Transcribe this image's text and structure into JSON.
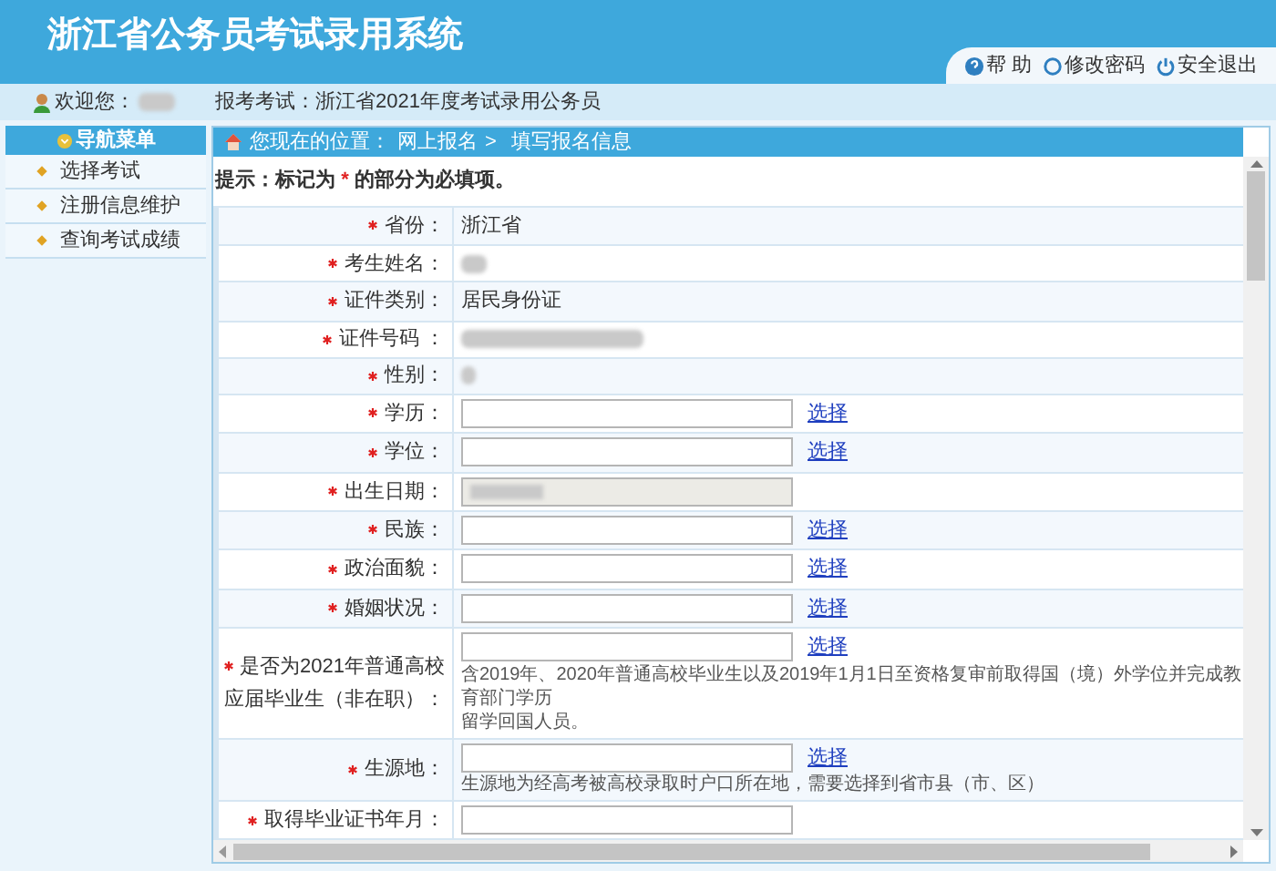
{
  "header": {
    "title": "浙江省公务员考试录用系统",
    "links": [
      {
        "label": "帮 助",
        "kind": "help"
      },
      {
        "label": "修改密码",
        "kind": "password"
      },
      {
        "label": "安全退出",
        "kind": "logout"
      }
    ]
  },
  "welcome": {
    "label": "欢迎您：",
    "exam": "报考考试：浙江省2021年度考试录用公务员"
  },
  "sidebar": {
    "title": "导航菜单",
    "items": [
      {
        "label": "选择考试"
      },
      {
        "label": "注册信息维护"
      },
      {
        "label": "查询考试成绩"
      }
    ]
  },
  "breadcrumb": {
    "prefix": "您现在的位置：",
    "items": [
      "网上报名",
      "填写报名信息"
    ],
    "separator": ">"
  },
  "tip": {
    "before": "提示：标记为",
    "mark": "*",
    "after": "的部分为必填项。"
  },
  "rows": [
    {
      "label": [
        "省份："
      ],
      "required": true,
      "kind": "text",
      "value": "浙江省"
    },
    {
      "label": [
        "考生姓名："
      ],
      "required": true,
      "kind": "redacted"
    },
    {
      "label": [
        "证件类别："
      ],
      "required": true,
      "kind": "text",
      "value": "居民身份证"
    },
    {
      "label": [
        "证件号码 ："
      ],
      "required": true,
      "kind": "redacted"
    },
    {
      "label": [
        "性别："
      ],
      "required": true,
      "kind": "redacted"
    },
    {
      "label": [
        "学历："
      ],
      "required": true,
      "kind": "input",
      "link": "选择"
    },
    {
      "label": [
        "学位："
      ],
      "required": true,
      "kind": "input",
      "link": "选择"
    },
    {
      "label": [
        "出生日期："
      ],
      "required": true,
      "kind": "disabled"
    },
    {
      "label": [
        "民族："
      ],
      "required": true,
      "kind": "input",
      "link": "选择"
    },
    {
      "label": [
        "政治面貌："
      ],
      "required": true,
      "kind": "input",
      "link": "选择"
    },
    {
      "label": [
        "婚姻状况："
      ],
      "required": true,
      "kind": "input",
      "link": "选择"
    },
    {
      "label": [
        "是否为2021年普通高校",
        "应届毕业生（非在职）："
      ],
      "required": true,
      "kind": "input",
      "link": "选择",
      "hint": [
        "含2019年、2020年普通高校毕业生以及2019年1月1日至资格复审前取得国（境）外学位并完成教育部门学历",
        "留学回国人员。"
      ]
    },
    {
      "label": [
        "生源地："
      ],
      "required": true,
      "kind": "input",
      "link": "选择",
      "hint": [
        "生源地为经高考被高校录取时户口所在地，需要选择到省市县（市、区）"
      ]
    },
    {
      "label": [
        "取得毕业证书年月："
      ],
      "required": true,
      "kind": "input"
    }
  ]
}
